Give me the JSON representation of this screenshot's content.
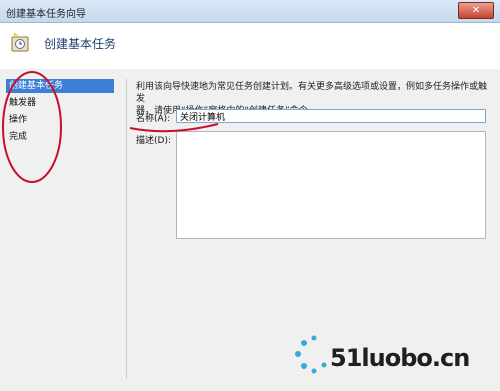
{
  "window": {
    "title": "创建基本任务向导",
    "close_label": "✕"
  },
  "header": {
    "title": "创建基本任务"
  },
  "sidebar": {
    "items": [
      {
        "label": "创建基本任务",
        "active": true
      },
      {
        "label": "触发器",
        "active": false
      },
      {
        "label": "操作",
        "active": false
      },
      {
        "label": "完成",
        "active": false
      }
    ]
  },
  "main": {
    "description_line1": "利用该向导快速地为常见任务创建计划。有关更多高级选项或设置，例如多任务操作或触发",
    "description_line2": "器，请使用“操作”窗格中的“创建任务”命令。",
    "name_label": "名称(A):",
    "name_value": "关闭计算机",
    "desc_label": "描述(D):",
    "desc_value": ""
  },
  "watermark": {
    "text": "51luobo.cn"
  },
  "colors": {
    "annotation": "#c8102e",
    "selection": "#3d7fd6",
    "header_title": "#1c3f6e"
  }
}
